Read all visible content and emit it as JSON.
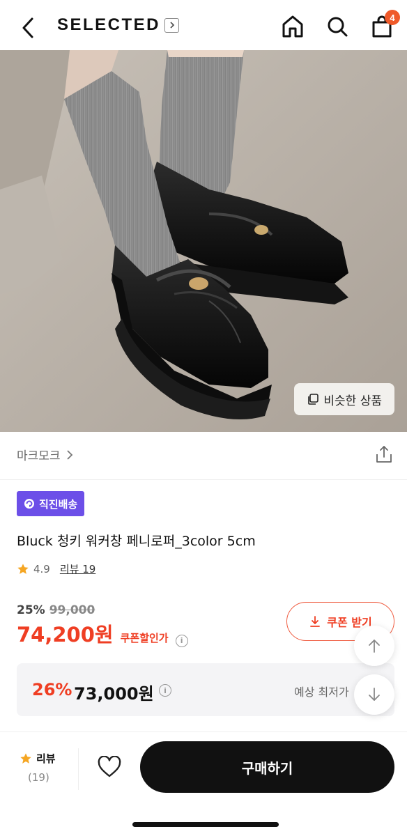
{
  "header": {
    "brand": "SELECTED",
    "cart_count": "4",
    "icons": [
      "back-icon",
      "chevron-right-icon",
      "home-icon",
      "search-icon",
      "shopping-bag-icon"
    ]
  },
  "hero": {
    "similar_label": "비슷한 상품"
  },
  "product": {
    "brand": "마크모크",
    "badge": "직진배송",
    "title": "Bluck 청키 워커창 페니로퍼_3color 5cm",
    "rating": "4.9",
    "review_link": "리뷰 19",
    "discount": "25%",
    "original_price": "99,000",
    "sale_price": "74,200원",
    "coupon_price_label": "쿠폰할인가",
    "coupon_button": "쿠폰 받기",
    "best_discount": "26%",
    "best_price": "73,000원",
    "best_label": "예상 최저가"
  },
  "bottom_bar": {
    "review_label": "리뷰",
    "review_count": "(19)",
    "buy_label": "구매하기"
  },
  "colors": {
    "accent_red": "#ef3e23",
    "badge_purple": "#6c4fe8",
    "cart_badge": "#ef5a2a",
    "star": "#f5a623"
  }
}
